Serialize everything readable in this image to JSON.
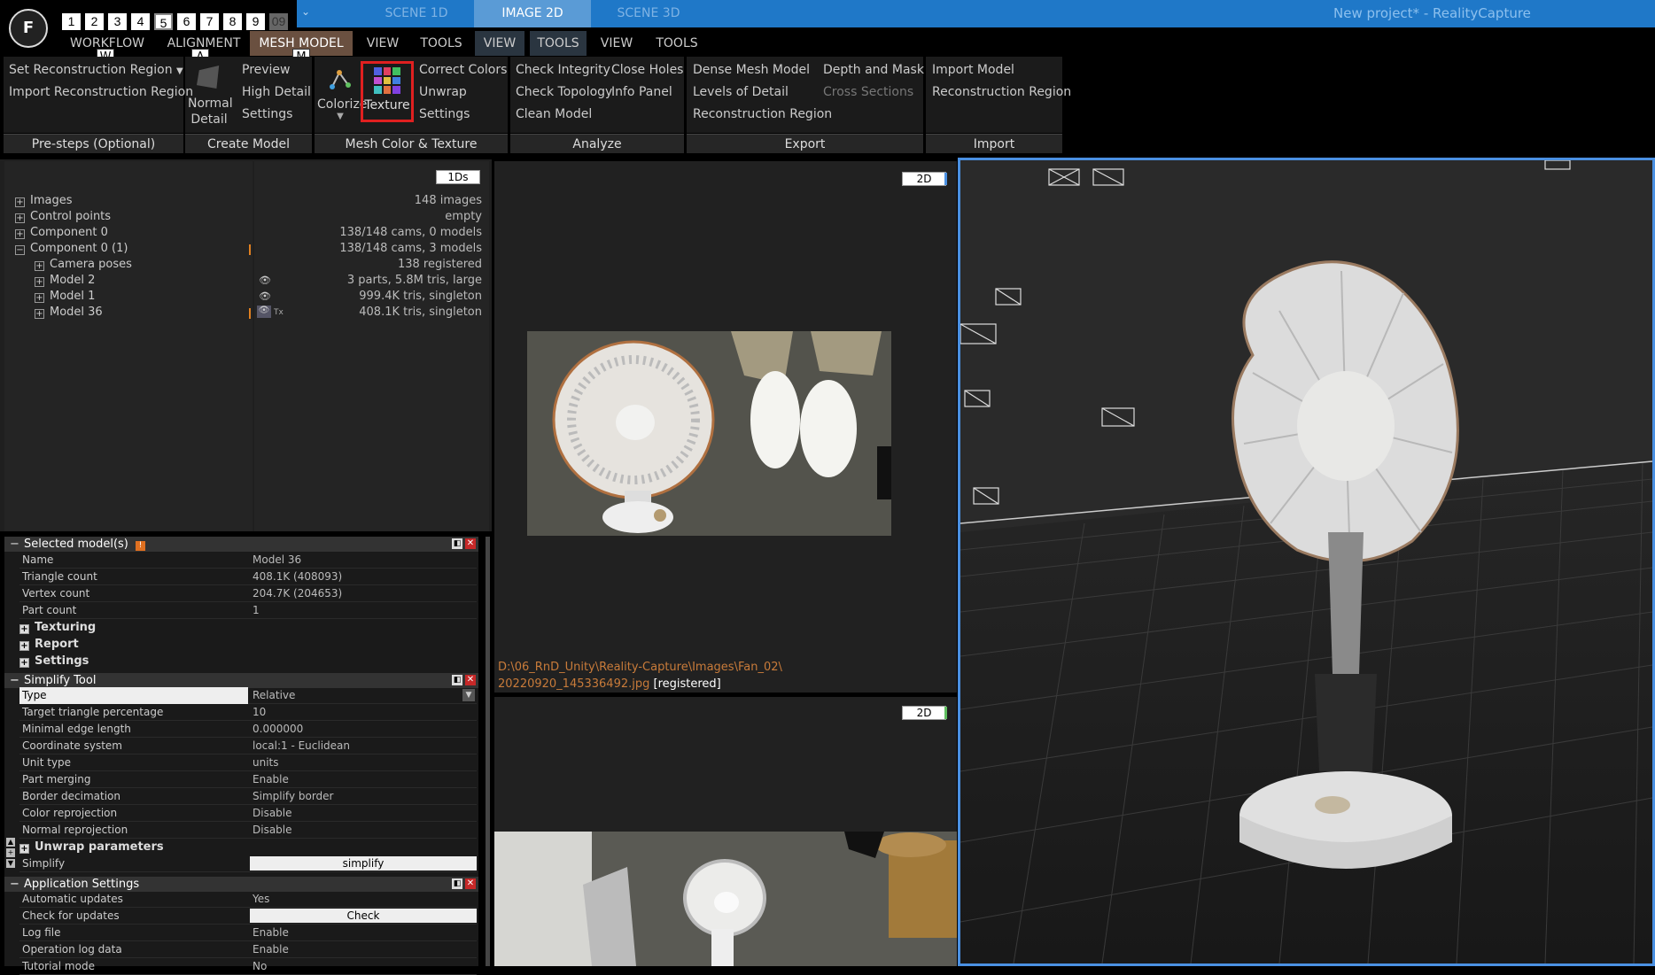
{
  "app": {
    "title": "New project* - RealityCapture",
    "logo_letter": "F"
  },
  "top_tabs": [
    {
      "label": "SCENE 1D",
      "active": false
    },
    {
      "label": "IMAGE 2D",
      "active": true
    },
    {
      "label": "SCENE 3D",
      "active": false
    }
  ],
  "layouts": [
    "1",
    "2",
    "3",
    "4",
    "5",
    "6",
    "7",
    "8",
    "9",
    "09"
  ],
  "hotkeys": {
    "workflow": "W",
    "alignment": "A",
    "mesh": "M"
  },
  "menu": {
    "workflow": "WORKFLOW",
    "alignment": "ALIGNMENT",
    "mesh_model": "MESH MODEL",
    "view1": "VIEW",
    "tools1": "TOOLS",
    "view2": "VIEW",
    "tools2": "TOOLS",
    "view3": "VIEW",
    "tools3": "TOOLS"
  },
  "ribbon": {
    "presteps": {
      "footer": "Pre-steps (Optional)",
      "set_region": "Set Reconstruction Region",
      "import_region": "Import Reconstruction Region"
    },
    "create_model": {
      "footer": "Create Model",
      "normal": "Normal",
      "detail": "Detail",
      "preview": "Preview",
      "high_detail": "High Detail",
      "settings": "Settings"
    },
    "color_texture": {
      "footer": "Mesh Color & Texture",
      "colorize": "Colorize",
      "texture": "Texture",
      "correct_colors": "Correct Colors",
      "unwrap": "Unwrap",
      "settings": "Settings"
    },
    "analyze": {
      "footer": "Analyze",
      "check_integrity": "Check Integrity",
      "check_topology": "Check Topology",
      "clean_model": "Clean Model",
      "close_holes": "Close Holes",
      "info_panel": "Info Panel"
    },
    "export": {
      "footer": "Export",
      "dense_mesh": "Dense Mesh Model",
      "levels_detail": "Levels of Detail",
      "recon_region": "Reconstruction Region",
      "depth_mask": "Depth and Mask",
      "cross_sections": "Cross Sections"
    },
    "import": {
      "footer": "Import",
      "import_model": "Import Model",
      "recon_region": "Reconstruction Region"
    }
  },
  "tree": {
    "badge": "1Ds",
    "rows": [
      {
        "label": "Images",
        "value": "148 images"
      },
      {
        "label": "Control points",
        "value": "empty"
      },
      {
        "label": "Component 0",
        "value": "138/148 cams, 0 models"
      },
      {
        "label": "Component 0 (1)",
        "value": "138/148 cams, 3 models"
      },
      {
        "label": "Camera poses",
        "value": "138 registered"
      },
      {
        "label": "Model 2",
        "value": "3 parts, 5.8M tris, large"
      },
      {
        "label": "Model 1",
        "value": "999.4K tris, singleton"
      },
      {
        "label": "Model 36",
        "value": "408.1K tris, singleton"
      }
    ]
  },
  "selected_model": {
    "header": "Selected model(s)",
    "rows": [
      {
        "k": "Name",
        "v": "Model 36"
      },
      {
        "k": "Triangle count",
        "v": "408.1K (408093)"
      },
      {
        "k": "Vertex count",
        "v": "204.7K (204653)"
      },
      {
        "k": "Part count",
        "v": "1"
      }
    ],
    "sections": [
      "Texturing",
      "Report",
      "Settings"
    ]
  },
  "simplify": {
    "header": "Simplify Tool",
    "rows": [
      {
        "k": "Type",
        "v": "Relative"
      },
      {
        "k": "Target triangle percentage",
        "v": "10"
      },
      {
        "k": "Minimal edge length",
        "v": "0.000000"
      },
      {
        "k": "Coordinate system",
        "v": "local:1 - Euclidean"
      },
      {
        "k": "Unit type",
        "v": "units"
      },
      {
        "k": "Part merging",
        "v": "Enable"
      },
      {
        "k": "Border decimation",
        "v": "Simplify border"
      },
      {
        "k": "Color reprojection",
        "v": "Disable"
      },
      {
        "k": "Normal reprojection",
        "v": "Disable"
      }
    ],
    "unwrap_section": "Unwrap parameters",
    "simplify_label": "Simplify",
    "simplify_btn": "simplify"
  },
  "app_settings": {
    "header": "Application Settings",
    "rows": [
      {
        "k": "Automatic updates",
        "v": "Yes"
      },
      {
        "k": "Check for updates",
        "v": "Check"
      },
      {
        "k": "Log file",
        "v": "Enable"
      },
      {
        "k": "Operation log data",
        "v": "Enable"
      },
      {
        "k": "Tutorial mode",
        "v": "No"
      }
    ]
  },
  "image2d": {
    "badge_top": "2D",
    "badge_bottom": "2D",
    "path_line1": "D:\\06_RnD_Unity\\Reality-Capture\\Images\\Fan_02\\",
    "path_line2": "20220920_145336492.jpg",
    "path_status": "[registered]"
  },
  "colors": {
    "accent_blue": "#1f78c8",
    "highlight_red": "#e02020",
    "mesh_tab": "#6a5040",
    "path_orange": "#c87b3a"
  }
}
